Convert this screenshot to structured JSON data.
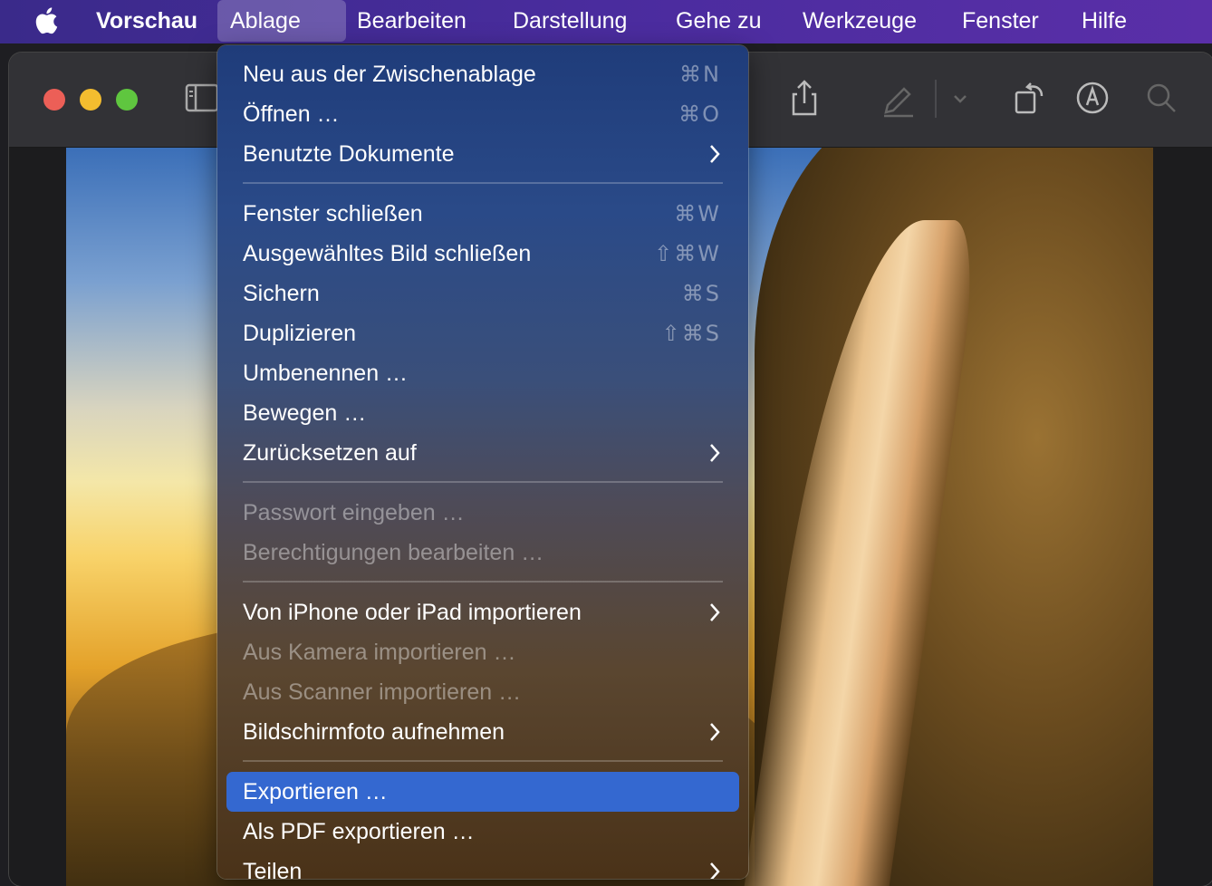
{
  "menubar": {
    "app": "Vorschau",
    "items": [
      "Ablage",
      "Bearbeiten",
      "Darstellung",
      "Gehe zu",
      "Werkzeuge",
      "Fenster",
      "Hilfe"
    ],
    "active": "Ablage"
  },
  "toolbar": {
    "icons": [
      "sidebar-toggle-icon",
      "share-icon",
      "highlight-pen-icon",
      "chevron-down-icon",
      "rotate-icon",
      "markup-icon",
      "search-icon"
    ]
  },
  "menu": {
    "items": [
      {
        "label": "Neu aus der Zwischenablage",
        "shortcut": "⌘N"
      },
      {
        "label": "Öffnen …",
        "shortcut": "⌘O"
      },
      {
        "label": "Benutzte Dokumente",
        "submenu": true
      },
      {
        "label": "Fenster schließen",
        "shortcut": "⌘W"
      },
      {
        "label": "Ausgewähltes Bild schließen",
        "shortcut": "⇧⌘W"
      },
      {
        "label": "Sichern",
        "shortcut": "⌘S"
      },
      {
        "label": "Duplizieren",
        "shortcut": "⇧⌘S"
      },
      {
        "label": "Umbenennen …"
      },
      {
        "label": "Bewegen …"
      },
      {
        "label": "Zurücksetzen auf",
        "submenu": true
      },
      {
        "label": "Passwort eingeben …",
        "disabled": true
      },
      {
        "label": "Berechtigungen bearbeiten …",
        "disabled": true
      },
      {
        "label": "Von iPhone oder iPad importieren",
        "submenu": true
      },
      {
        "label": "Aus Kamera importieren …",
        "disabled": true
      },
      {
        "label": "Aus Scanner importieren …",
        "disabled": true
      },
      {
        "label": "Bildschirmfoto aufnehmen",
        "submenu": true
      },
      {
        "label": "Exportieren …",
        "highlighted": true
      },
      {
        "label": "Als PDF exportieren …"
      },
      {
        "label": "Teilen",
        "submenu": true
      }
    ]
  },
  "colors": {
    "menubar": "#4a2c9e",
    "highlight": "#3468d0",
    "close": "#ec5f57",
    "minimize": "#f4bd2f",
    "maximize": "#5fc63f"
  }
}
